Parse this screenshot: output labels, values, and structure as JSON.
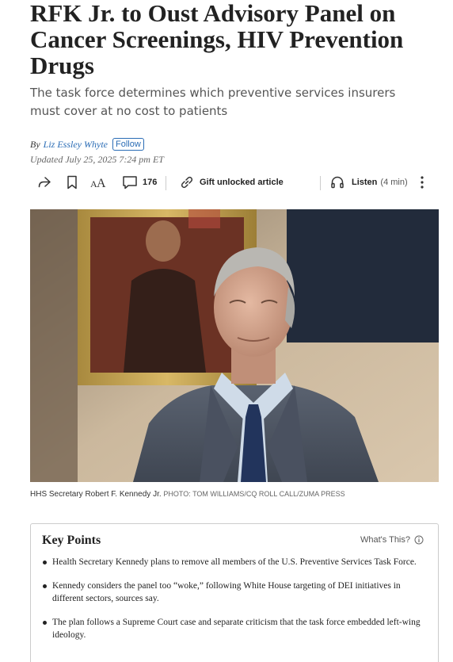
{
  "article": {
    "headline": "RFK Jr. to Oust Advisory Panel on Cancer Screenings, HIV Prevention Drugs",
    "dek": "The task force determines which preventive services insurers must cover at no cost to patients",
    "byline_prefix": "By",
    "author": "Liz Essley Whyte",
    "follow_label": "Follow",
    "updated": "Updated July 25, 2025 7:24 pm ET"
  },
  "toolbar": {
    "comment_count": "176",
    "gift_label": "Gift unlocked article",
    "listen_label": "Listen",
    "listen_duration": "(4 min)"
  },
  "photo": {
    "caption": "HHS Secretary Robert F. Kennedy Jr.",
    "credit": "PHOTO: TOM WILLIAMS/CQ ROLL CALL/ZUMA PRESS"
  },
  "key_points": {
    "title": "Key Points",
    "whats_this": "What's This?",
    "items": [
      "Health Secretary Kennedy plans to remove all members of the U.S. Preventive Services Task Force.",
      "Kennedy considers the panel too “woke,” following White House targeting of DEI initiatives in different sectors, sources say.",
      "The plan follows a Supreme Court case and separate criticism that the task force embedded left-wing ideology."
    ]
  },
  "colors": {
    "link": "#2a6cb5",
    "headline": "#222222",
    "dek": "#555555"
  }
}
